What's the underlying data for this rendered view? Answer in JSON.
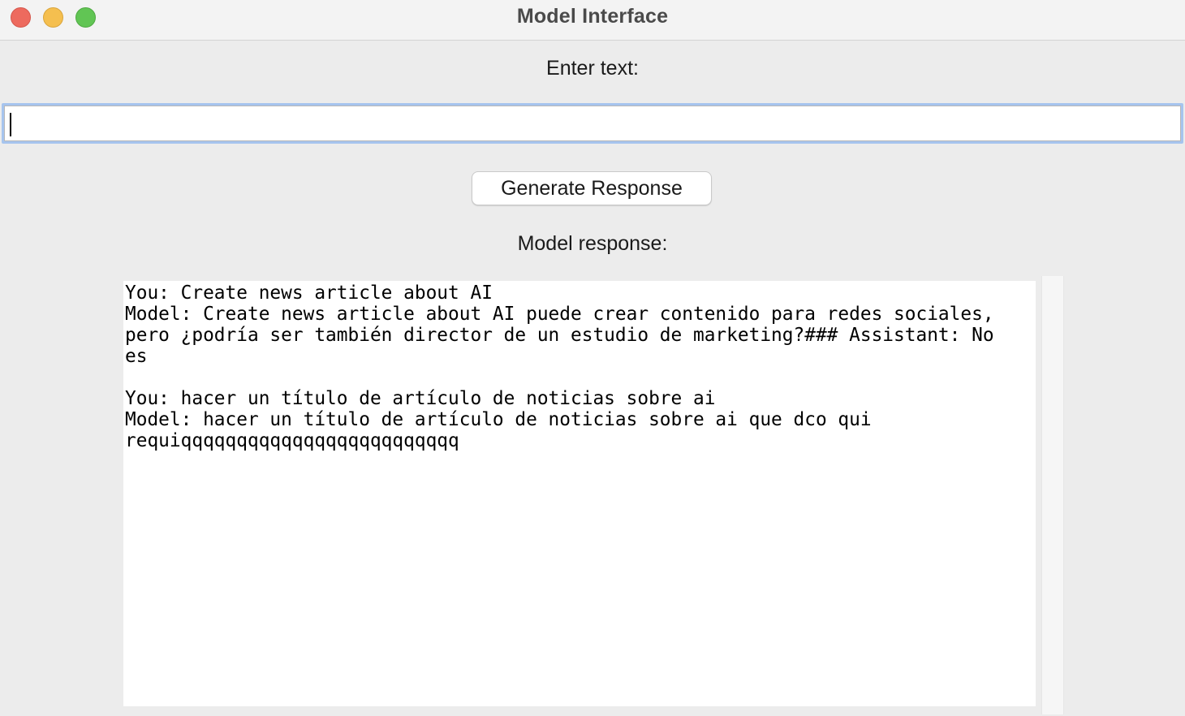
{
  "window": {
    "title": "Model Interface"
  },
  "input": {
    "label": "Enter text:",
    "value": ""
  },
  "generate_button": {
    "label": "Generate Response"
  },
  "response": {
    "label": "Model response:",
    "lines": [
      "You: Create news article about AI",
      "Model: Create news article about AI puede crear contenido para redes sociales,",
      "pero ¿podría ser también director de un estudio de marketing?### Assistant: No",
      "es",
      "",
      "You: hacer un título de artículo de noticias sobre ai",
      "Model: hacer un título de artículo de noticias sobre ai que dco qui",
      "requiqqqqqqqqqqqqqqqqqqqqqqqqq"
    ]
  },
  "colors": {
    "window_bg": "#ececec",
    "close": "#ed6a5e",
    "minimize": "#f5bf4f",
    "maximize": "#61c554",
    "focus_ring": "#a6c4ee"
  }
}
